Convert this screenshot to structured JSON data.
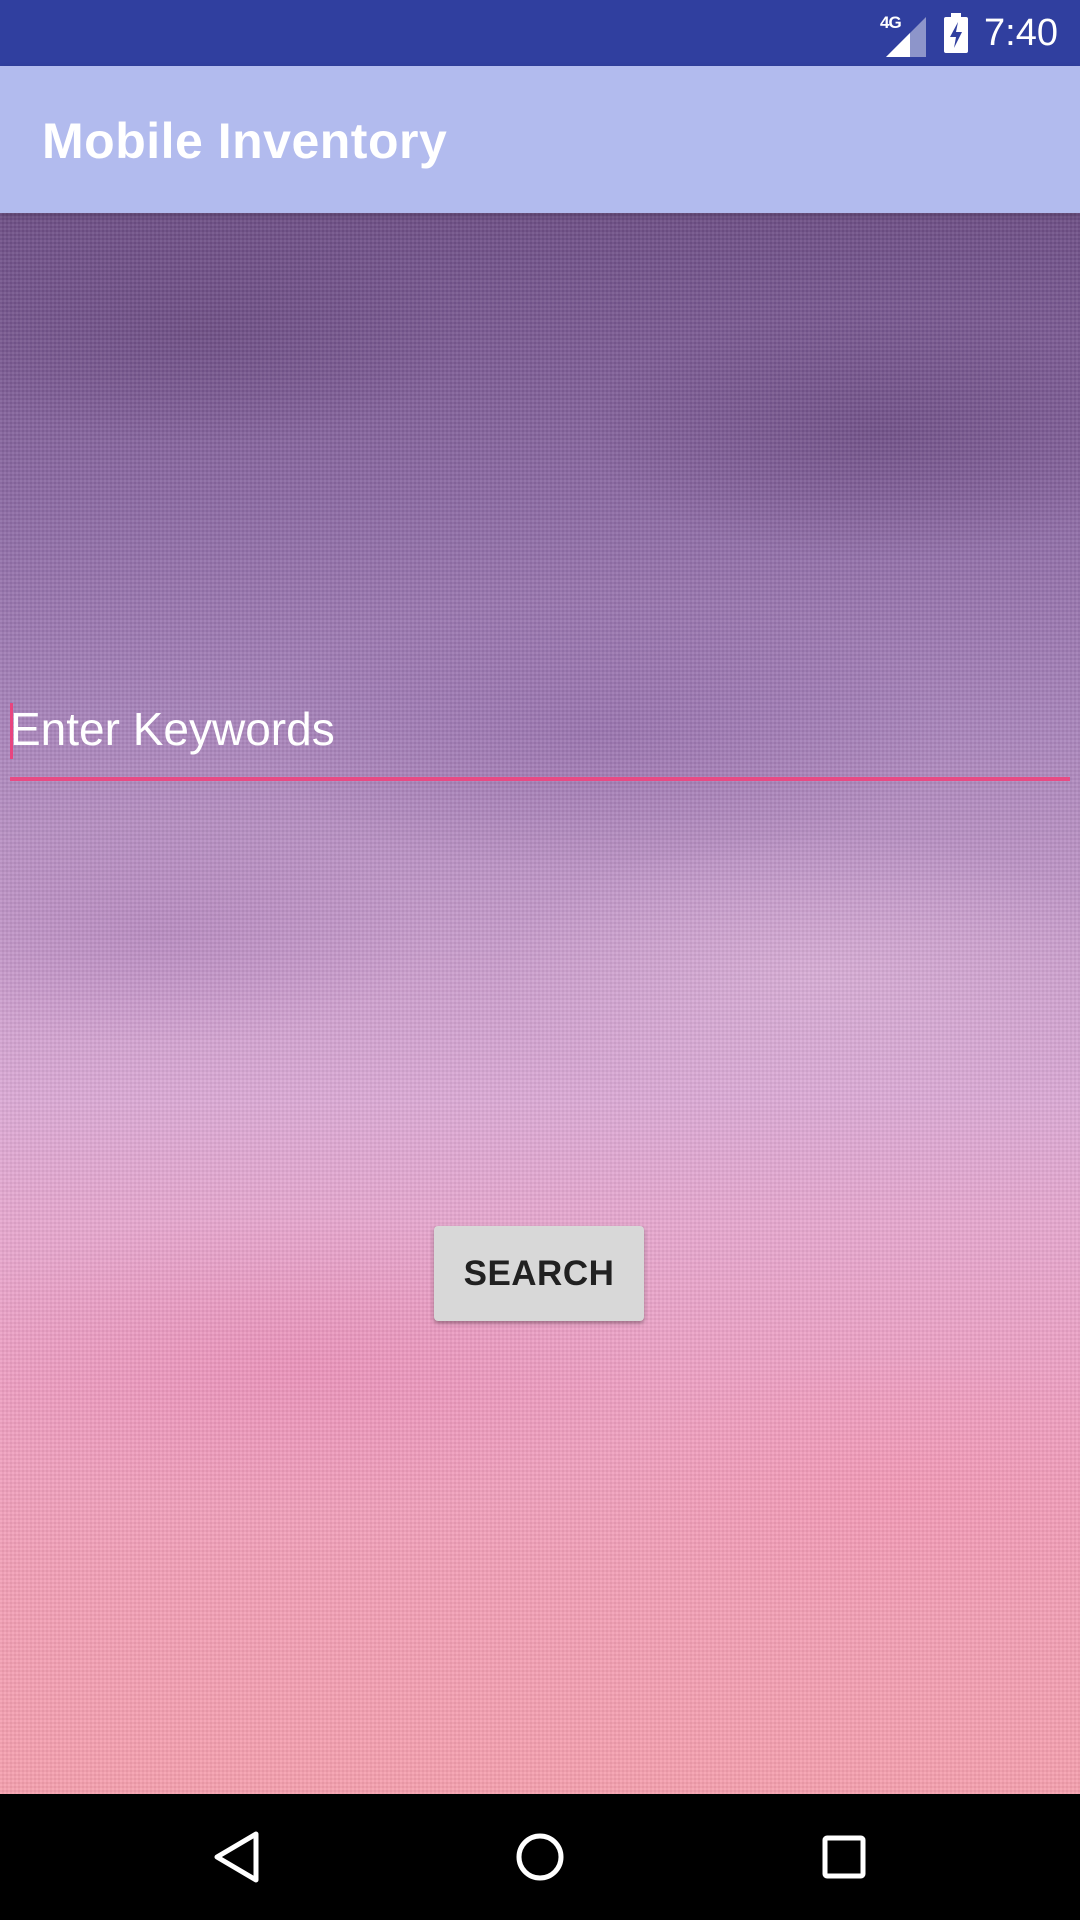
{
  "status_bar": {
    "network_type": "4G",
    "time": "7:40",
    "icons": [
      "signal-icon",
      "battery-charging-icon"
    ]
  },
  "app_bar": {
    "title": "Mobile Inventory"
  },
  "search": {
    "placeholder": "Enter Keywords",
    "value": "",
    "button_label": "SEARCH"
  },
  "nav_bar": {
    "icons": [
      "back-icon",
      "home-icon",
      "recents-icon"
    ]
  },
  "colors": {
    "status_bar": "#303f9f",
    "app_bar": "#b2bbee",
    "accent": "#e84a84",
    "button": "#d8d8d8"
  }
}
